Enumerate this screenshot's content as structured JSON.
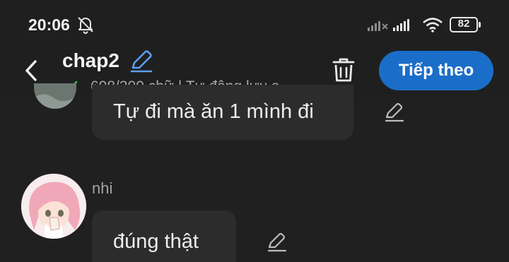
{
  "status_bar": {
    "time": "20:06",
    "battery": "82",
    "icons": [
      "bell-off-icon",
      "signal-x-icon",
      "signal-icon",
      "wifi-icon",
      "battery-icon"
    ]
  },
  "header": {
    "title": "chap2",
    "subtitle": "608/300 chữ | Tự động lưu s",
    "next_label": "Tiếp theo",
    "accent_color": "#1a6ec9",
    "icons": [
      "back-icon",
      "pencil-icon",
      "check-icon",
      "trash-icon"
    ]
  },
  "messages": [
    {
      "text": "Tự đi mà ăn 1 mình đi"
    },
    {
      "author": "nhi",
      "text": "đúng thật"
    }
  ]
}
